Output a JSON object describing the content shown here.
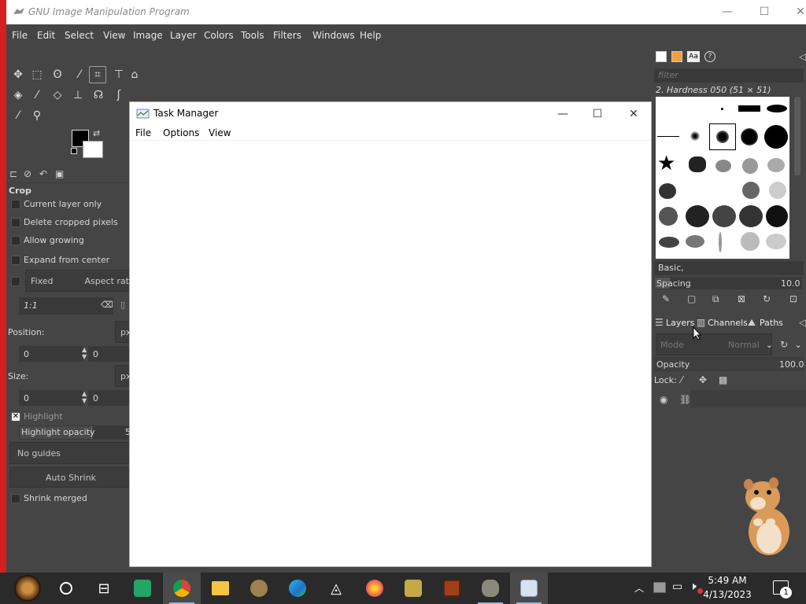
{
  "gimp": {
    "title": "GNU Image Manipulation Program",
    "menus": [
      "File",
      "Edit",
      "Select",
      "View",
      "Image",
      "Layer",
      "Colors",
      "Tools",
      "Filters",
      "Windows",
      "Help"
    ],
    "tool_options": {
      "section_title": "Crop",
      "current_layer_only": "Current layer only",
      "delete_cropped_pixels": "Delete cropped pixels",
      "allow_growing": "Allow growing",
      "expand_from_center": "Expand from center",
      "fixed_label": "Fixed",
      "aspect_ratio_label": "Aspect ratio",
      "ratio_value": "1:1",
      "position_label": "Position:",
      "position_unit": "px",
      "position_x": "0",
      "position_y": "0",
      "size_label": "Size:",
      "size_unit": "px",
      "size_w": "0",
      "size_h": "0",
      "highlight_label": "Highlight",
      "highlight_opacity_label": "Highlight opacity",
      "highlight_opacity_value": "5",
      "guides_value": "No guides",
      "auto_shrink": "Auto Shrink",
      "shrink_merged": "Shrink merged"
    },
    "brushes": {
      "filter_placeholder": "filter",
      "selected_brush": "2. Hardness 050 (51 × 51)",
      "tag_value": "Basic,",
      "spacing_label": "Spacing",
      "spacing_value": "10.0"
    },
    "layers": {
      "tab_layers": "Layers",
      "tab_channels": "Channels",
      "tab_paths": "Paths",
      "mode_label": "Mode",
      "mode_value": "Normal",
      "opacity_label": "Opacity",
      "opacity_value": "100.0",
      "lock_label": "Lock:"
    }
  },
  "task_manager": {
    "title": "Task Manager",
    "menus": [
      "File",
      "Options",
      "View"
    ]
  },
  "taskbar": {
    "time": "5:49 AM",
    "date": "4/13/2023",
    "notification_count": "1"
  },
  "colors": {
    "gimp_bg": "#454545",
    "left_edge_accent": "#d42020",
    "taskbar_bg": "#2a2a2a"
  }
}
